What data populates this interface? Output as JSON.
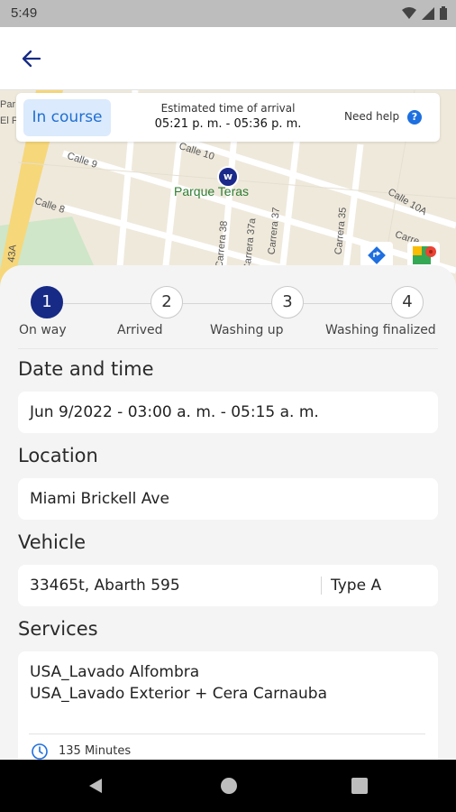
{
  "status_bar": {
    "time": "5:49"
  },
  "map": {
    "labels": {
      "street_1": "Calle 9",
      "street_2": "Calle 10",
      "street_3": "Calle 8",
      "street_4": "Calle 10A",
      "carrera_1": "Carrera 38",
      "carrera_2": "Carrera 37a",
      "carrera_3": "Carrera 37",
      "carrera_4": "Carrera 35",
      "road_1": "43A",
      "corner_1": "Par",
      "corner_2": "El P",
      "corner_3": "Carre",
      "corner_4": "34",
      "park": "Parque Teras"
    },
    "pin_glyph": "w"
  },
  "info": {
    "status": "In course",
    "eta_label": "Estimated time of arrival",
    "eta_value": "05:21 p. m. - 05:36 p. m.",
    "help_label": "Need help",
    "help_glyph": "?"
  },
  "steps": [
    {
      "num": "1",
      "label": "On way",
      "active": true
    },
    {
      "num": "2",
      "label": "Arrived",
      "active": false
    },
    {
      "num": "3",
      "label": "Washing up",
      "active": false
    },
    {
      "num": "4",
      "label": "Washing finalized",
      "active": false
    }
  ],
  "sections": {
    "date_time": {
      "title": "Date and time",
      "value": "Jun 9/2022 - 03:00 a. m. - 05:15 a. m."
    },
    "location": {
      "title": "Location",
      "value": "Miami Brickell Ave"
    },
    "vehicle": {
      "title": "Vehicle",
      "value": "33465t, Abarth 595",
      "type": "Type A"
    },
    "services": {
      "title": "Services",
      "items": [
        "USA_Lavado Alfombra",
        "USA_Lavado Exterior + Cera Carnauba"
      ],
      "duration": "135 Minutes"
    }
  },
  "icons": {
    "back": "arrow-left-icon",
    "help": "question-icon",
    "clock": "clock-icon",
    "directions": "directions-icon",
    "maps": "google-maps-icon"
  },
  "colors": {
    "primary": "#172a85",
    "badge_bg": "#dbeafc",
    "badge_text": "#1f6fd1",
    "help_blue": "#1e6fe0",
    "park_green": "#2e7d32"
  }
}
